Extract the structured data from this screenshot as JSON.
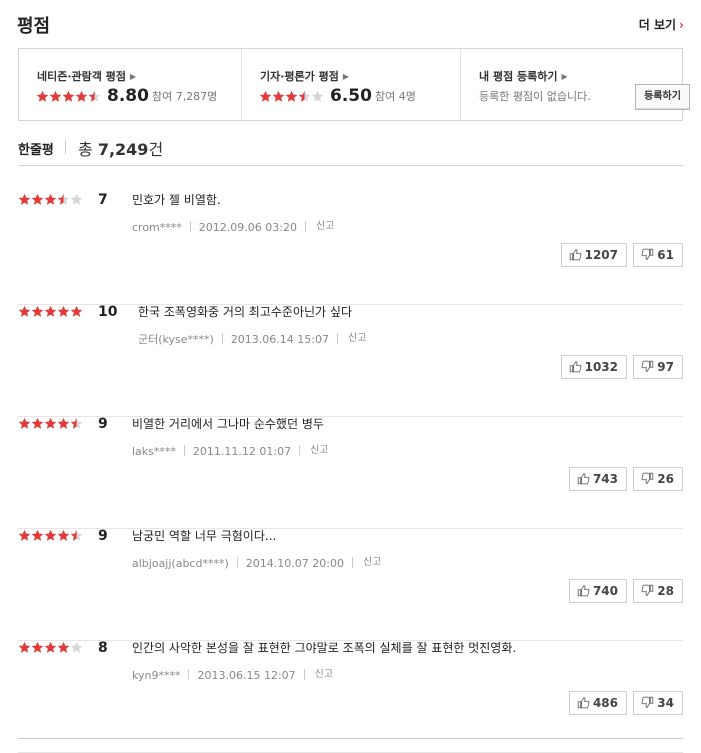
{
  "page": {
    "title": "평점",
    "more_label": "더 보기"
  },
  "summary": {
    "netizen": {
      "label": "네티즌·관람객 평점",
      "score": "8.80",
      "participants": "참여 7,287명",
      "rating": 8.8
    },
    "critic": {
      "label": "기자·평론가 평점",
      "score": "6.50",
      "participants": "참여 4명",
      "rating": 6.5
    },
    "mine": {
      "label": "내 평점 등록하기",
      "empty_text": "등록한 평점이 없습니다.",
      "register_label": "등록하기"
    }
  },
  "count": {
    "label": "한줄평",
    "prefix": "총",
    "number": "7,249",
    "suffix": "건"
  },
  "report_label": "신고",
  "colors": {
    "star_on": "#e13b3b",
    "star_off": "#d6d6d6",
    "accent": "#e73737"
  },
  "reviews": [
    {
      "rating": 7,
      "score": "7",
      "text": "민호가 젤 비열함.",
      "user": "crom****",
      "date": "2012.09.06 03:20",
      "likes": "1207",
      "dislikes": "61"
    },
    {
      "rating": 10,
      "score": "10",
      "text": "한국 조폭영화중 거의 최고수준아닌가 싶다",
      "user": "군터(kyse****)",
      "date": "2013.06.14 15:07",
      "likes": "1032",
      "dislikes": "97"
    },
    {
      "rating": 9,
      "score": "9",
      "text": "비열한 거리에서 그나마 순수했던 병두",
      "user": "laks****",
      "date": "2011.11.12 01:07",
      "likes": "743",
      "dislikes": "26"
    },
    {
      "rating": 9,
      "score": "9",
      "text": "남궁민 역할 너무 극혐이다...",
      "user": "albjoajj(abcd****)",
      "date": "2014.10.07 20:00",
      "likes": "740",
      "dislikes": "28"
    },
    {
      "rating": 8,
      "score": "8",
      "text": "인간의 사악한 본성을 잘 표현한 그야말로 조폭의 실체를 잘 표현한 멋진영화.",
      "user": "kyn9****",
      "date": "2013.06.15 12:07",
      "likes": "486",
      "dislikes": "34"
    }
  ]
}
